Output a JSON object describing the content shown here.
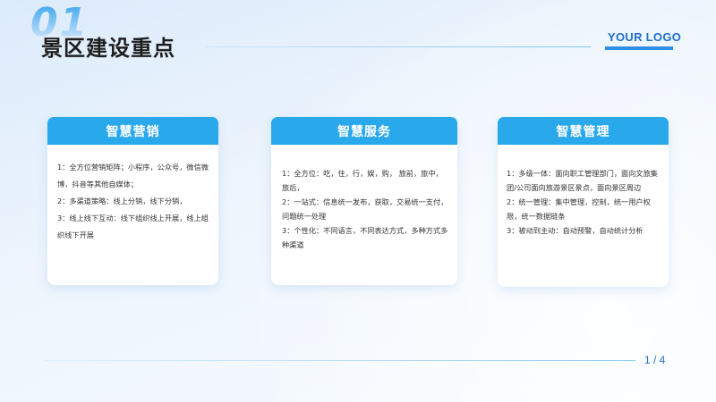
{
  "header": {
    "number": "01",
    "title": "景区建设重点",
    "logo": "YOUR LOGO"
  },
  "cards": [
    {
      "title": "智慧营销",
      "items": [
        "1：全方位营销矩阵；小程序，公众号，微信微博，抖音等其他自媒体；",
        "2：多渠道策略：线上分销，线下分销，",
        "3：线上线下互动：线下组织线上开展，线上组织线下开展"
      ]
    },
    {
      "title": "智慧服务",
      "items": [
        "1：全方位：吃，住，行，娱，购， 旅前，旅中，旅后，",
        "2：一站式：信息统一发布，获取，交易统一支付，问题统一处理",
        "3：个性化：不同语言，不同表达方式，多种方式多种渠道"
      ]
    },
    {
      "title": "智慧管理",
      "items": [
        "1：多级一体：面向职工管理部门，面向文旅集团/公司面向旅游景区景点，面向景区周边",
        "2：统一管理：集中管理，控制，统一用户权限，统一数据链条",
        "3：被动到主动：自动预警，自动统计分析"
      ]
    }
  ],
  "footer": {
    "page": "1 / 4"
  }
}
